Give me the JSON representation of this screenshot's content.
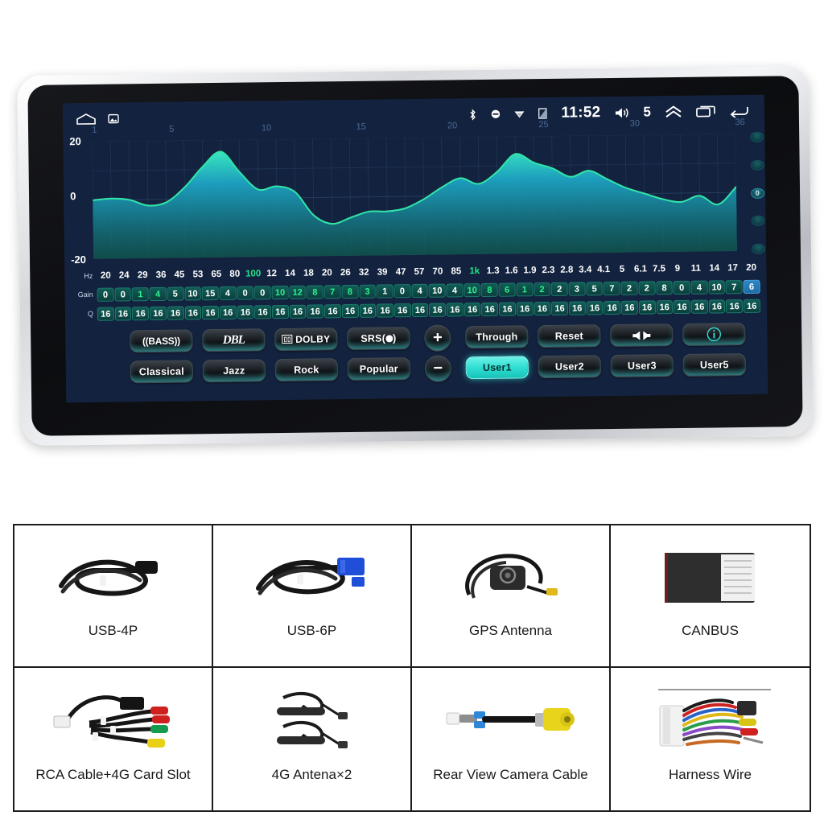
{
  "device": {
    "statusbar": {
      "home_icon": "home-icon",
      "screenshot_icon": "screenshot-icon",
      "bluetooth_icon": "bluetooth-icon",
      "mute_icon": "mute-icon",
      "wifi_icon": "wifi-icon",
      "sim_icon": "sim-signal-icon",
      "time": "11:52",
      "volume_icon": "volume-icon",
      "volume_level": "5",
      "expand_icon": "chevron-up-icon",
      "recents_icon": "recents-icon",
      "back_icon": "back-icon"
    },
    "ruler_ticks": [
      "1",
      "5",
      "10",
      "15",
      "20",
      "25",
      "30",
      "36"
    ],
    "slider_rail": {
      "center_label": "0",
      "dot_count": 5
    },
    "rows": {
      "freq_label": "Hz",
      "gain_label": "Gain",
      "q_label": "Q",
      "frequencies": [
        "20",
        "24",
        "29",
        "36",
        "45",
        "53",
        "65",
        "80",
        "100",
        "12",
        "14",
        "18",
        "20",
        "26",
        "32",
        "39",
        "47",
        "57",
        "70",
        "85",
        "1k",
        "1.3",
        "1.6",
        "1.9",
        "2.3",
        "2.8",
        "3.4",
        "4.1",
        "5",
        "6.1",
        "7.5",
        "9",
        "11",
        "14",
        "17",
        "20"
      ],
      "freq_highlight_index": [
        8,
        20
      ],
      "gains": [
        "0",
        "0",
        "1",
        "4",
        "5",
        "10",
        "15",
        "4",
        "0",
        "0",
        "10",
        "12",
        "8",
        "7",
        "8",
        "3",
        "1",
        "0",
        "4",
        "10",
        "4",
        "10",
        "8",
        "6",
        "1",
        "2",
        "2",
        "3",
        "5",
        "7",
        "2",
        "2",
        "8",
        "0",
        "4",
        "10",
        "7",
        "6"
      ],
      "gain_green_index": [
        2,
        3,
        10,
        11,
        12,
        13,
        14,
        15,
        21,
        22,
        23,
        24,
        25
      ],
      "gain_selected_index": 37,
      "q_values": [
        "16",
        "16",
        "16",
        "16",
        "16",
        "16",
        "16",
        "16",
        "16",
        "16",
        "16",
        "16",
        "16",
        "16",
        "16",
        "16",
        "16",
        "16",
        "16",
        "16",
        "16",
        "16",
        "16",
        "16",
        "16",
        "16",
        "16",
        "16",
        "16",
        "16",
        "16",
        "16",
        "16",
        "16",
        "16",
        "16",
        "16",
        "16"
      ]
    },
    "buttons": {
      "row1_left": [
        {
          "label": "((BASS))",
          "name": "bass-button",
          "style": "bass"
        },
        {
          "label": "DBL",
          "name": "dbl-button",
          "style": "dbl"
        },
        {
          "label": "DOLBY",
          "name": "dolby-button",
          "style": "dolby"
        },
        {
          "label": "SRS",
          "name": "srs-button",
          "style": "srs"
        }
      ],
      "row2_left": [
        {
          "label": "Classical",
          "name": "preset-classical-button"
        },
        {
          "label": "Jazz",
          "name": "preset-jazz-button"
        },
        {
          "label": "Rock",
          "name": "preset-rock-button"
        },
        {
          "label": "Popular",
          "name": "preset-popular-button"
        }
      ],
      "plus": "+",
      "minus": "−",
      "row1_right": [
        {
          "label": "Through",
          "name": "through-button",
          "style": "text"
        },
        {
          "label": "Reset",
          "name": "reset-button",
          "style": "text"
        },
        {
          "label": "",
          "name": "balance-button",
          "style": "balance"
        },
        {
          "label": "",
          "name": "info-button",
          "style": "info"
        }
      ],
      "row2_right": [
        {
          "label": "User1",
          "name": "user1-button",
          "active": true
        },
        {
          "label": "User2",
          "name": "user2-button",
          "active": false
        },
        {
          "label": "User3",
          "name": "user3-button",
          "active": false
        },
        {
          "label": "User5",
          "name": "user5-button",
          "active": false
        }
      ]
    },
    "colors": {
      "screen_bg": "#13233f",
      "curve_stroke": "#31e6a8",
      "accent_cyan": "#2fded2",
      "chip_green": "#2ef08d",
      "chip_selected": "#2d86c4"
    }
  },
  "accessories": [
    {
      "caption": "USB-4P",
      "art": "usb-4p-cable"
    },
    {
      "caption": "USB-6P",
      "art": "usb-6p-cable"
    },
    {
      "caption": "GPS Antenna",
      "art": "gps-antenna"
    },
    {
      "caption": "CANBUS",
      "art": "canbus-box"
    },
    {
      "caption": "RCA Cable+4G Card Slot",
      "art": "rca-cable"
    },
    {
      "caption": "4G Antena×2",
      "art": "4g-antenna"
    },
    {
      "caption": "Rear View Camera Cable",
      "art": "camera-cable"
    },
    {
      "caption": "Harness Wire",
      "art": "harness-wire"
    }
  ],
  "chart_data": {
    "type": "area",
    "title": "",
    "xlabel": "",
    "ylabel": "",
    "ylim": [
      -20,
      20
    ],
    "yticks": [
      "20",
      "0",
      "-20"
    ],
    "xticks": [
      "1",
      "5",
      "10",
      "15",
      "20",
      "25",
      "30",
      "36"
    ],
    "grid": true,
    "legend": "none",
    "x": [
      1,
      2,
      3,
      4,
      5,
      6,
      7,
      8,
      9,
      10,
      11,
      12,
      13,
      14,
      15,
      16,
      17,
      18,
      19,
      20,
      21,
      22,
      23,
      24,
      25,
      26,
      27,
      28,
      29,
      30,
      31,
      32,
      33,
      34,
      35,
      36
    ],
    "values": [
      0,
      0.5,
      0,
      -2,
      -1,
      4,
      11,
      16,
      9,
      3,
      4,
      2,
      -6,
      -9,
      -7,
      -5,
      -5,
      -4,
      -1,
      3,
      6,
      4,
      8,
      14,
      11,
      9,
      6,
      8,
      5,
      2,
      0,
      -2,
      -3,
      -1,
      -4,
      2
    ]
  }
}
